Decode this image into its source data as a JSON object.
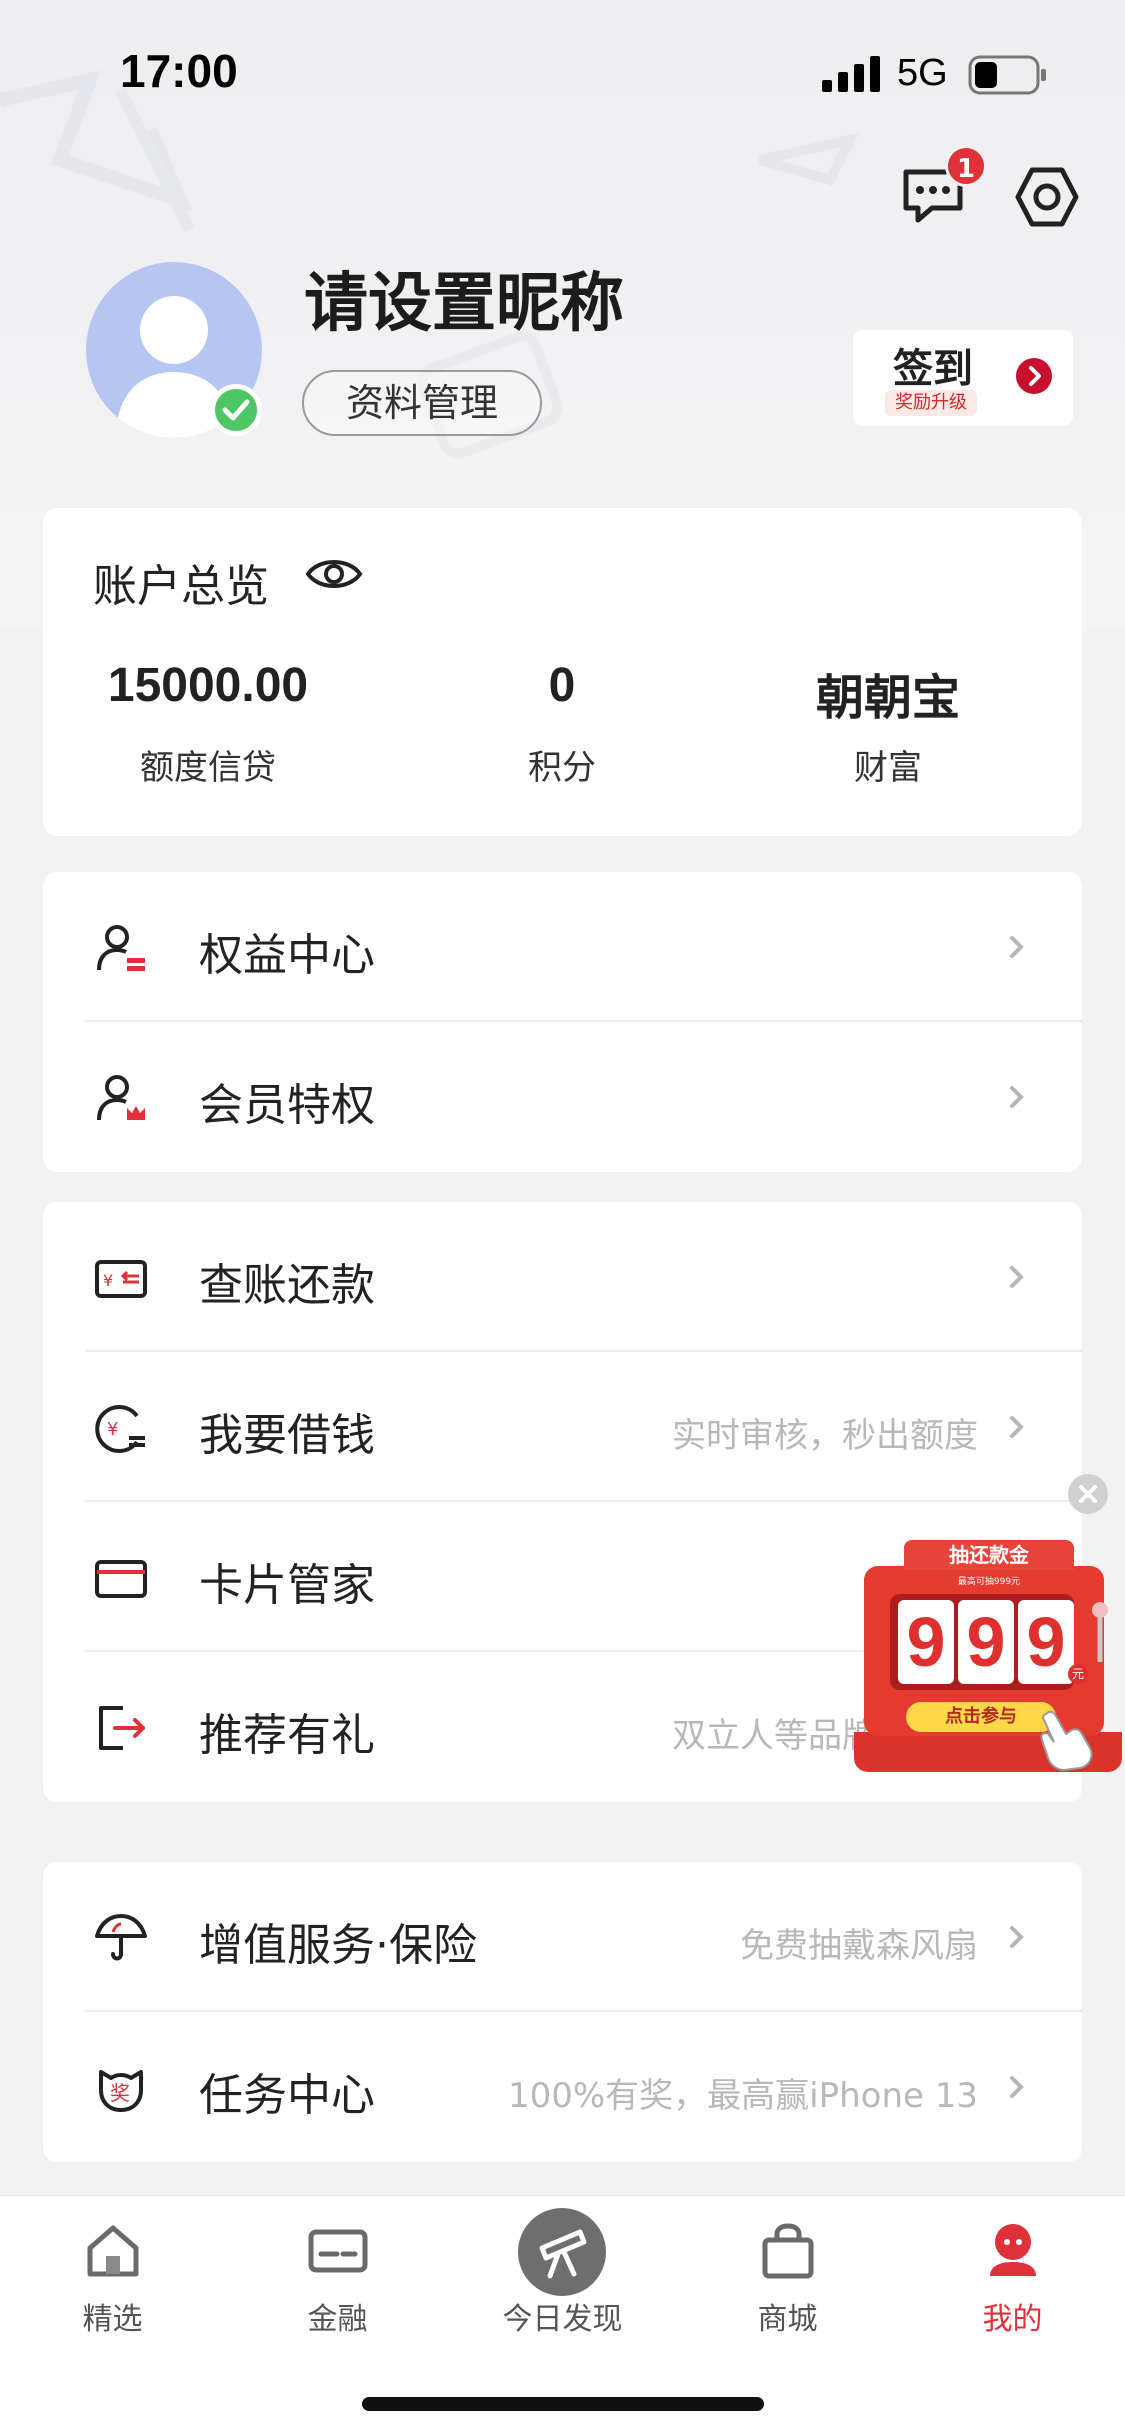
{
  "status_bar": {
    "time": "17:00",
    "network": "5G"
  },
  "header": {
    "message_badge_count": "1"
  },
  "profile": {
    "nickname": "请设置昵称",
    "manage_button": "资料管理",
    "checkin": {
      "label": "签到",
      "sub": "奖励升级"
    }
  },
  "overview": {
    "title": "账户总览",
    "stats": [
      {
        "value": "15000.00",
        "label": "额度信贷"
      },
      {
        "value": "0",
        "label": "积分"
      },
      {
        "value": "朝朝宝",
        "label": "财富"
      }
    ]
  },
  "menu": {
    "rights": [
      {
        "label": "权益中心",
        "hint": ""
      },
      {
        "label": "会员特权",
        "hint": ""
      }
    ],
    "services": [
      {
        "label": "查账还款",
        "hint": ""
      },
      {
        "label": "我要借钱",
        "hint": "实时审核，秒出额度"
      },
      {
        "label": "卡片管家",
        "hint": ""
      },
      {
        "label": "推荐有礼",
        "hint": "双立人等品牌好礼等"
      }
    ],
    "extra": [
      {
        "label": "增值服务·保险",
        "hint": "免费抽戴森风扇"
      },
      {
        "label": "任务中心",
        "hint": "100%有奖，最高赢iPhone 13"
      }
    ]
  },
  "promo": {
    "title": "抽还款金",
    "subtitle": "最高可抽999元",
    "digits": [
      "9",
      "9",
      "9"
    ],
    "unit": "元",
    "cta": "点击参与"
  },
  "tabs": [
    {
      "label": "精选",
      "icon": "home-icon",
      "active": false
    },
    {
      "label": "金融",
      "icon": "card-icon",
      "active": false
    },
    {
      "label": "今日发现",
      "icon": "telescope-icon",
      "active": false
    },
    {
      "label": "商城",
      "icon": "shopping-bag-icon",
      "active": false
    },
    {
      "label": "我的",
      "icon": "profile-icon",
      "active": true
    }
  ],
  "colors": {
    "accent": "#e0303a",
    "brand_red": "#c8102e",
    "avatar_bg": "#b6c6f3",
    "verified": "#4cc764"
  }
}
